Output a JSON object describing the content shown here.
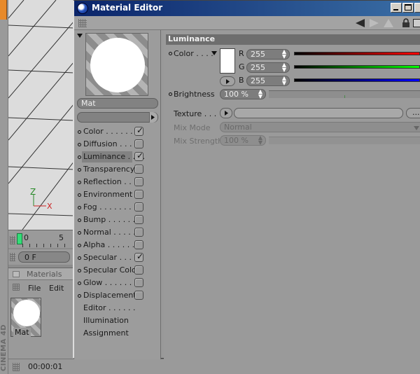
{
  "window": {
    "title": "Material Editor"
  },
  "preview": {
    "material_name": "Mat"
  },
  "channels": [
    {
      "label": "Color",
      "dots": true,
      "checked": true,
      "bullet": true
    },
    {
      "label": "Diffusion",
      "dots": true,
      "checked": false,
      "bullet": true
    },
    {
      "label": "Luminance",
      "dots": true,
      "checked": true,
      "bullet": true,
      "selected": true
    },
    {
      "label": "Transparency",
      "dots": false,
      "checked": false,
      "bullet": true
    },
    {
      "label": "Reflection",
      "dots": true,
      "checked": false,
      "bullet": true
    },
    {
      "label": "Environment",
      "dots": false,
      "checked": false,
      "bullet": true
    },
    {
      "label": "Fog",
      "dots": true,
      "checked": false,
      "bullet": true
    },
    {
      "label": "Bump",
      "dots": true,
      "checked": false,
      "bullet": true
    },
    {
      "label": "Normal",
      "dots": true,
      "checked": false,
      "bullet": true
    },
    {
      "label": "Alpha",
      "dots": true,
      "checked": false,
      "bullet": true
    },
    {
      "label": "Specular",
      "dots": true,
      "checked": true,
      "bullet": true
    },
    {
      "label": "Specular Color",
      "dots": false,
      "checked": false,
      "bullet": true
    },
    {
      "label": "Glow",
      "dots": true,
      "checked": false,
      "bullet": true
    },
    {
      "label": "Displacement",
      "dots": false,
      "checked": false,
      "bullet": true
    },
    {
      "label": "Editor",
      "dots": true,
      "checked": null,
      "bullet": false
    },
    {
      "label": "Illumination",
      "dots": false,
      "checked": null,
      "bullet": false
    },
    {
      "label": "Assignment",
      "dots": false,
      "checked": null,
      "bullet": false
    }
  ],
  "luminance": {
    "header": "Luminance",
    "color_label": "Color",
    "r_label": "R",
    "r_value": "255",
    "g_label": "G",
    "g_value": "255",
    "b_label": "B",
    "b_value": "255",
    "brightness_label": "Brightness",
    "brightness_value": "100 %",
    "texture_label": "Texture",
    "texture_more": "...",
    "mix_mode_label": "Mix Mode",
    "mix_mode_value": "Normal",
    "mix_strength_label": "Mix Strength",
    "mix_strength_value": "100 %"
  },
  "timeline": {
    "tick_0": "0",
    "tick_5": "5",
    "frame_value": "0 F"
  },
  "materials": {
    "title": "Materials",
    "menu": [
      "File",
      "Edit"
    ],
    "item_name": "Mat"
  },
  "status": {
    "time": "00:00:01"
  },
  "brand": "CINEMA 4D",
  "colors": {
    "title_bar": "#0a246a",
    "r_slider": "#ff0000",
    "g_slider": "#00ff00",
    "b_slider": "#0000ff",
    "timeline_marker": "#33dd77"
  }
}
